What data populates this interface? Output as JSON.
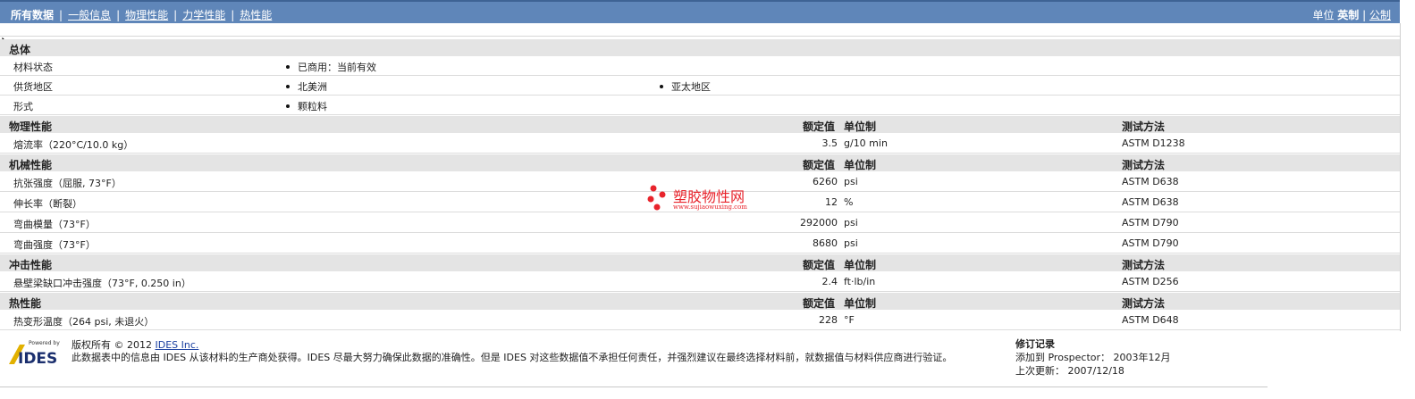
{
  "nav": {
    "tabs": [
      "所有数据",
      "一般信息",
      "物理性能",
      "力学性能",
      "热性能"
    ],
    "units_label": "单位",
    "unit_english": "英制",
    "unit_metric": "公制"
  },
  "general": {
    "title": "总体",
    "status_label": "材料状态",
    "status_value": "已商用：当前有效",
    "region_label": "供货地区",
    "region_1": "北美洲",
    "region_2": "亚太地区",
    "form_label": "形式",
    "form_value": "颗粒料"
  },
  "columns": {
    "nominal": "额定值",
    "unit": "单位制",
    "method": "测试方法"
  },
  "physical": {
    "title": "物理性能",
    "rows": [
      {
        "name": "熔流率（220°C/10.0 kg）",
        "value": "3.5",
        "unit": "g/10 min",
        "method": "ASTM D1238"
      }
    ]
  },
  "mechanical": {
    "title": "机械性能",
    "rows": [
      {
        "name": "抗张强度（屈服, 73°F）",
        "value": "6260",
        "unit": "psi",
        "method": "ASTM D638"
      },
      {
        "name": "伸长率（断裂）",
        "value": "12",
        "unit": "%",
        "method": "ASTM D638"
      },
      {
        "name": "弯曲模量（73°F）",
        "value": "292000",
        "unit": "psi",
        "method": "ASTM D790"
      },
      {
        "name": "弯曲强度（73°F）",
        "value": "8680",
        "unit": "psi",
        "method": "ASTM D790"
      }
    ]
  },
  "impact": {
    "title": "冲击性能",
    "rows": [
      {
        "name": "悬壁梁缺口冲击强度（73°F, 0.250 in）",
        "value": "2.4",
        "unit": "ft·lb/in",
        "method": "ASTM D256"
      }
    ]
  },
  "thermal": {
    "title": "热性能",
    "rows": [
      {
        "name": "热变形温度（264 psi, 未退火）",
        "value": "228",
        "unit": "°F",
        "method": "ASTM D648"
      }
    ]
  },
  "footer": {
    "logo_small": "Powered by",
    "logo_text": "IDES",
    "copyright": "版权所有 © 2012",
    "company_link": "IDES Inc.",
    "disclaimer": "此数据表中的信息由 IDES 从该材料的生产商处获得。IDES 尽最大努力确保此数据的准确性。但是 IDES 对这些数据值不承担任何责任，并强烈建议在最终选择材料前，就数据值与材料供应商进行验证。",
    "revision_title": "修订记录",
    "added_label": "添加到 Prospector：",
    "added_value": "2003年12月",
    "updated_label": "上次更新：",
    "updated_value": "2007/12/18"
  },
  "watermark": {
    "brand": "塑胶物性网",
    "url": "www.sujiaowuxing.com",
    "color": "#e8242c"
  },
  "colors": {
    "nav_bg": "#5f86b9",
    "header_bg": "#e4e4e4"
  }
}
